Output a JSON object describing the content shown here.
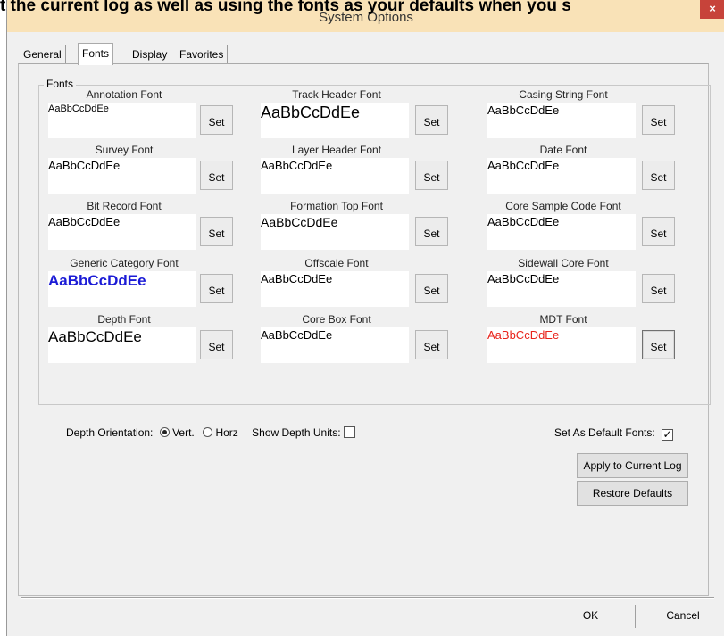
{
  "overlay_caption": "t the current log as well as using the fonts as your defaults when you s",
  "window": {
    "title": "System Options",
    "close_glyph": "×"
  },
  "tabs": [
    {
      "label": "General",
      "active": false
    },
    {
      "label": "Fonts",
      "active": true
    },
    {
      "label": "Display",
      "active": false
    },
    {
      "label": "Favorites",
      "active": false
    }
  ],
  "fonts_group": {
    "legend": "Fonts",
    "set_label": "Set",
    "items": [
      {
        "label": "Annotation Font",
        "sample": "AaBbCcDdEe",
        "color": "#000000",
        "size": "11px",
        "bold": false
      },
      {
        "label": "Track Header Font",
        "sample": "AaBbCcDdEe",
        "color": "#000000",
        "size": "18px",
        "bold": false
      },
      {
        "label": "Casing String Font",
        "sample": "AaBbCcDdEe",
        "color": "#000000",
        "size": "13px",
        "bold": false
      },
      {
        "label": "Survey Font",
        "sample": "AaBbCcDdEe",
        "color": "#000000",
        "size": "13px",
        "bold": false
      },
      {
        "label": "Layer Header Font",
        "sample": "AaBbCcDdEe",
        "color": "#000000",
        "size": "13px",
        "bold": false
      },
      {
        "label": "Date Font",
        "sample": "AaBbCcDdEe",
        "color": "#000000",
        "size": "13px",
        "bold": false
      },
      {
        "label": "Bit Record Font",
        "sample": "AaBbCcDdEe",
        "color": "#000000",
        "size": "13px",
        "bold": false
      },
      {
        "label": "Formation Top Font",
        "sample": "AaBbCcDdEe",
        "color": "#000000",
        "size": "14px",
        "bold": false
      },
      {
        "label": "Core Sample Code Font",
        "sample": "AaBbCcDdEe",
        "color": "#000000",
        "size": "13px",
        "bold": false
      },
      {
        "label": "Generic Category Font",
        "sample": "AaBbCcDdEe",
        "color": "#1b1bd6",
        "size": "17px",
        "bold": true
      },
      {
        "label": "Offscale Font",
        "sample": "AaBbCcDdEe",
        "color": "#000000",
        "size": "13px",
        "bold": false
      },
      {
        "label": "Sidewall Core Font",
        "sample": "AaBbCcDdEe",
        "color": "#000000",
        "size": "13px",
        "bold": false
      },
      {
        "label": "Depth Font",
        "sample": "AaBbCcDdEe",
        "color": "#000000",
        "size": "17px",
        "bold": false
      },
      {
        "label": "Core Box Font",
        "sample": "AaBbCcDdEe",
        "color": "#000000",
        "size": "13px",
        "bold": false
      },
      {
        "label": "MDT Font",
        "sample": "AaBbCcDdEe",
        "color": "#e8221a",
        "size": "13px",
        "bold": false
      }
    ]
  },
  "options": {
    "depth_orientation_label": "Depth Orientation:",
    "vert_label": "Vert.",
    "horz_label": "Horz",
    "vert_selected": true,
    "show_depth_units_label": "Show Depth Units:",
    "show_depth_units_checked": false,
    "set_default_fonts_label": "Set As Default Fonts:",
    "set_default_fonts_checked": true,
    "check_glyph": "✓"
  },
  "actions": {
    "apply_label": "Apply to Current Log",
    "restore_label": "Restore Defaults",
    "ok_label": "OK",
    "cancel_label": "Cancel"
  }
}
